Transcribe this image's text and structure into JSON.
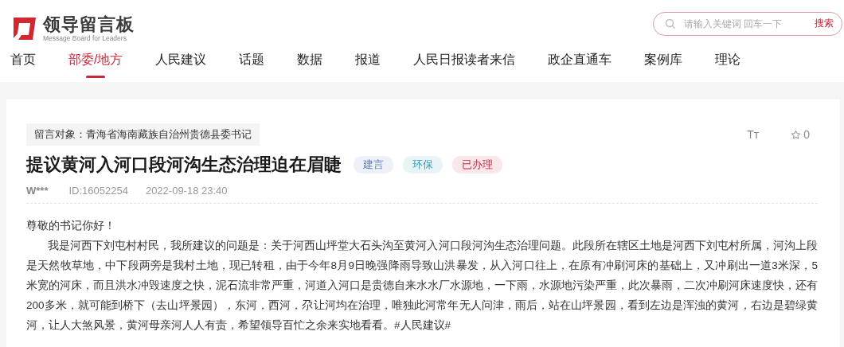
{
  "logo": {
    "title": "领导留言板",
    "subtitle": "Message Board for Leaders"
  },
  "search": {
    "placeholder": "请输入关键词 回车一下",
    "button": "搜索"
  },
  "nav": [
    {
      "label": "首页",
      "selected": false
    },
    {
      "label": "部委/地方",
      "selected": true
    },
    {
      "label": "人民建议",
      "selected": false
    },
    {
      "label": "话题",
      "selected": false
    },
    {
      "label": "数据",
      "selected": false
    },
    {
      "label": "报道",
      "selected": false
    },
    {
      "label": "人民日报读者来信",
      "selected": false
    },
    {
      "label": "政企直通车",
      "selected": false
    },
    {
      "label": "案例库",
      "selected": false
    },
    {
      "label": "理论",
      "selected": false
    }
  ],
  "message": {
    "target": "留言对象：青海省海南藏族自治州贵德县委书记",
    "font_size_button": "Tт",
    "favorites": "0",
    "title": "提议黄河入河口段河沟生态治理迫在眉睫",
    "tags": [
      {
        "label": "建言",
        "color": "#5a7bb5"
      },
      {
        "label": "环保",
        "color": "#3a9ab8"
      },
      {
        "label": "已办理",
        "color": "#c8283c"
      }
    ],
    "author": "W***",
    "id": "ID:16052254",
    "time": "2022-09-18 23:40",
    "greeting": "尊敬的书记你好！",
    "body": "我是河西下刘屯村村民，我所建议的问题是：关于河西山坪堂大石头沟至黄河入河口段河沟生态治理问题。此段所在辖区土地是河西下刘屯村所属，河沟上段是天然牧草地，中下段两旁是我村土地，现已转租，由于今年8月9日晚强降雨导致山洪暴发，从入河口往上，在原有冲刷河床的基础上，又冲刷出一道3米深，5米宽的河床，而且洪水冲毁速度之快，泥石流非常严重，河道入河口是贵德自来水水厂水源地，一下雨，水源地污染严重，此次暴雨，二次冲刷河床速度快，还有200多米，就可能到桥下（去山坪景园），东河，西河，尕让河均在治理，唯独此河常年无人问津，雨后，站在山坪景园，看到左边是浑浊的黄河，右边是碧绿黄河，让人大煞风景，黄河母亲河人人有责，希望领导百忙之余来实地看看。#人民建议#"
  }
}
